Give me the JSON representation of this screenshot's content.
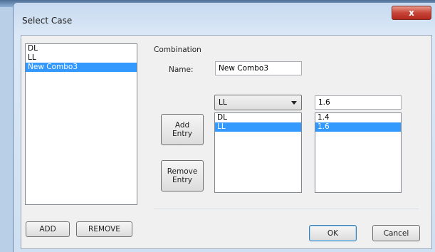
{
  "window": {
    "title": "Select Case",
    "close_glyph": "x"
  },
  "case_list": {
    "items": [
      {
        "label": "DL",
        "selected": false
      },
      {
        "label": "LL",
        "selected": false
      },
      {
        "label": "New Combo3",
        "selected": true
      }
    ]
  },
  "left_buttons": {
    "add": "ADD",
    "remove": "REMOVE"
  },
  "combination": {
    "group_label": "Combination",
    "name_label": "Name:",
    "name_value": "New Combo3",
    "case_select_value": "LL",
    "factor_value": "1.6",
    "add_entry": "Add\nEntry",
    "remove_entry": "Remove\nEntry",
    "entries": [
      {
        "case": "DL",
        "factor": "1.4",
        "selected": false
      },
      {
        "case": "LL",
        "factor": "1.6",
        "selected": true
      }
    ]
  },
  "footer": {
    "ok": "OK",
    "cancel": "Cancel"
  },
  "colors": {
    "selection": "#3399ff",
    "title_gradient_top": "#c7daf0",
    "close_red": "#c8453a"
  }
}
